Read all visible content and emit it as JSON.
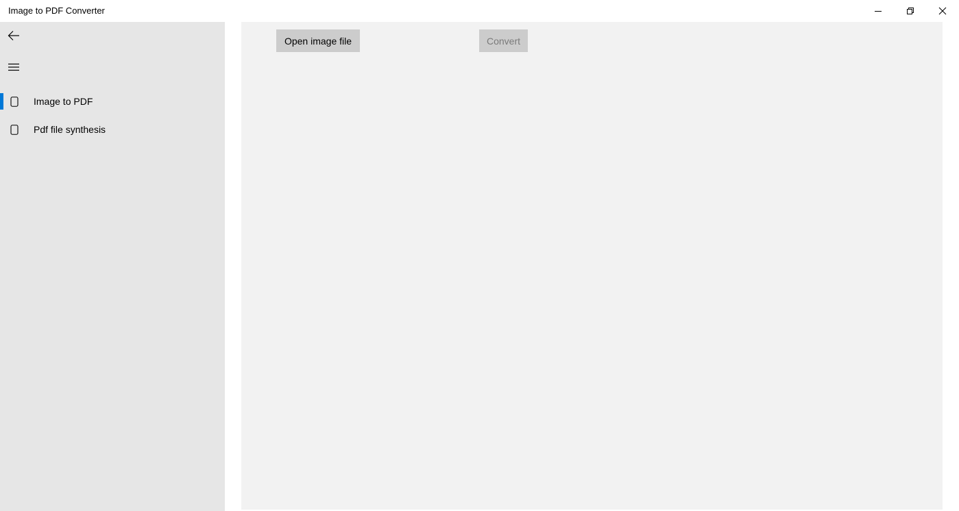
{
  "window": {
    "title": "Image to PDF Converter",
    "controls": {
      "minimize_icon": "minimize-icon",
      "restore_icon": "restore-icon",
      "close_icon": "close-icon"
    }
  },
  "sidebar": {
    "back_icon": "back-arrow-icon",
    "menu_icon": "hamburger-icon",
    "items": [
      {
        "label": "Image to PDF",
        "icon": "page-icon",
        "selected": true
      },
      {
        "label": "Pdf file synthesis",
        "icon": "page-icon",
        "selected": false
      }
    ],
    "accent_color": "#0078d7",
    "background_color": "#e6e6e6"
  },
  "main": {
    "open_button_label": "Open image file",
    "convert_button_label": "Convert",
    "convert_enabled": false,
    "background_color": "#f2f2f2"
  }
}
